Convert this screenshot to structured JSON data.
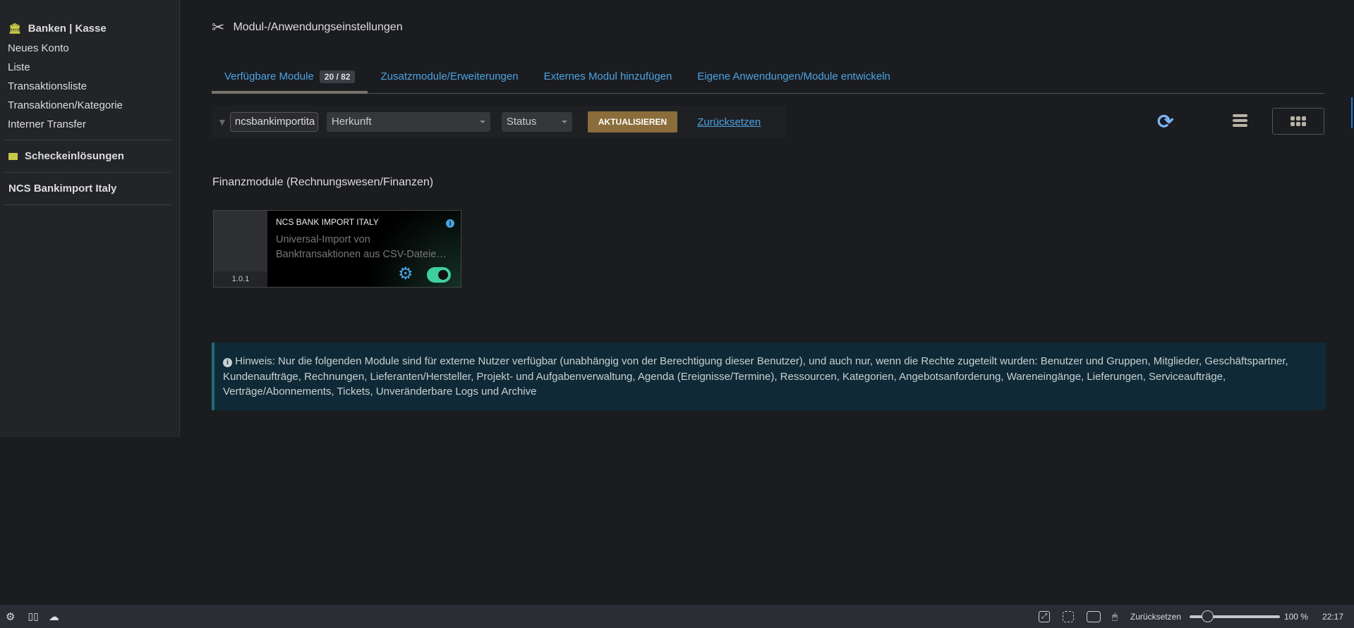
{
  "sidebar": {
    "section1": "Banken | Kasse",
    "items": [
      "Neues Konto",
      "Liste",
      "Transaktionsliste",
      "Transaktionen/Kategorie",
      "Interner Transfer"
    ],
    "section2": "Scheckeinlösungen",
    "section3": "NCS Bankimport Italy"
  },
  "header": {
    "title": "Modul-/Anwendungseinstellungen"
  },
  "tabs": [
    {
      "label": "Verfügbare Module",
      "badge": "20 / 82"
    },
    {
      "label": "Zusatzmodule/Erweiterungen"
    },
    {
      "label": "Externes Modul hinzufügen"
    },
    {
      "label": "Eigene Anwendungen/Module entwickeln"
    }
  ],
  "filter": {
    "search_value": "ncsbankimportita",
    "origin": "Herkunft",
    "status": "Status",
    "update_label": "AKTUALISIEREN",
    "reset_label": "Zurücksetzen"
  },
  "section_title": "Finanzmodule (Rechnungswesen/Finanzen)",
  "module": {
    "name": "NCS BANK IMPORT ITALY",
    "description": "Universal-Import von Banktransaktionen aus CSV-Dateie…",
    "version": "1.0.1",
    "enabled": true
  },
  "notice": "Hinweis: Nur die folgenden Module sind für externe Nutzer verfügbar (unabhängig von der Berechtigung dieser Benutzer), und auch nur, wenn die Rechte zugeteilt wurden: Benutzer und Gruppen, Mitglieder, Geschäftspartner, Kundenaufträge, Rechnungen, Lieferanten/Hersteller, Projekt- und Aufgabenverwaltung, Agenda (Ereignisse/Termine), Ressourcen, Kategorien, Angebotsanforderung, Wareneingänge, Lieferungen, Serviceaufträge, Verträge/Abonnements, Tickets, Unveränderbare Logs und Archive",
  "taskbar": {
    "reset_label": "Zurücksetzen",
    "zoom": "100 %",
    "zoom_fraction": 0.2,
    "time": "22:17"
  },
  "colors": {
    "accent": "#4ba3e3",
    "button": "#8a6d3b",
    "toggle": "#3ecfa0"
  }
}
